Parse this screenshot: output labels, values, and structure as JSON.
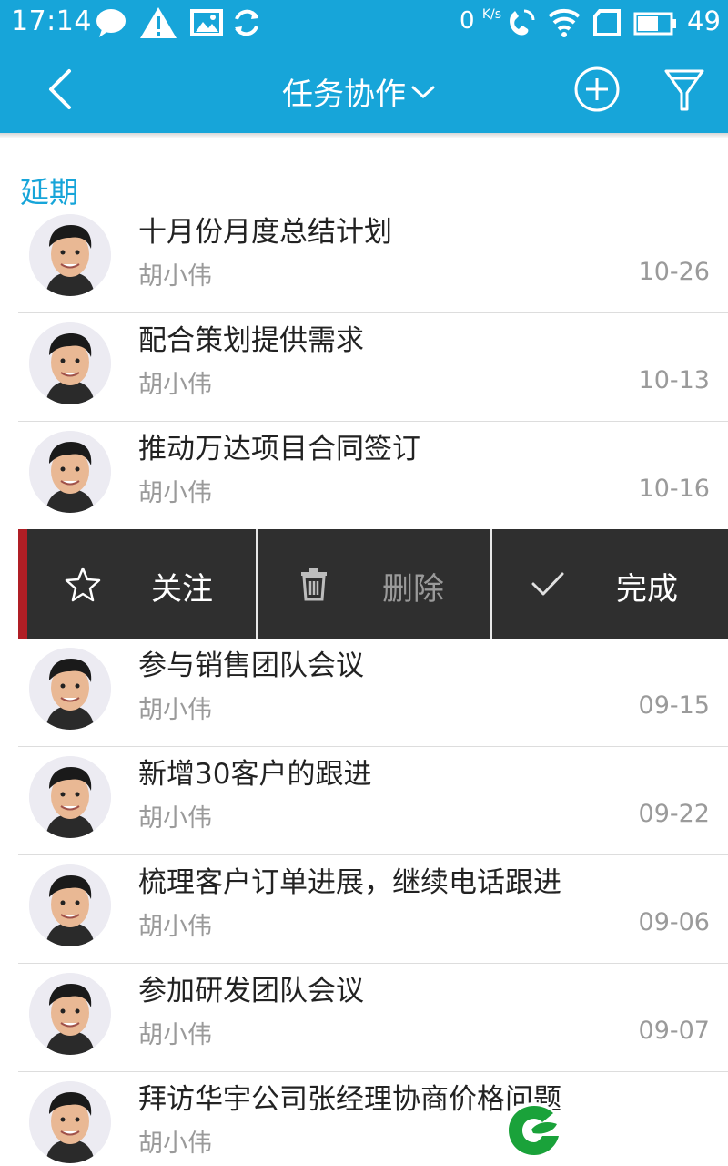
{
  "status_bar": {
    "time": "17:14",
    "net_speed": "0",
    "net_speed_unit": "K/s",
    "battery": "49",
    "icons": [
      "chat-bubble-icon",
      "warning-icon",
      "image-icon",
      "sync-icon",
      "vibrate-icon",
      "wifi-icon",
      "sim-icon",
      "battery-icon"
    ]
  },
  "header": {
    "title": "任务协作",
    "icons": [
      "back-icon",
      "chevron-down-icon",
      "add-circle-icon",
      "filter-icon"
    ]
  },
  "section": {
    "title": "延期"
  },
  "tasks": [
    {
      "title": "十月份月度总结计划",
      "assignee": "胡小伟",
      "date": "10-26"
    },
    {
      "title": "配合策划提供需求",
      "assignee": "胡小伟",
      "date": "10-13"
    },
    {
      "title": "推动万达项目合同签订",
      "assignee": "胡小伟",
      "date": "10-16"
    },
    {
      "title": "参与销售团队会议",
      "assignee": "胡小伟",
      "date": "09-15"
    },
    {
      "title": "新增30客户的跟进",
      "assignee": "胡小伟",
      "date": "09-22"
    },
    {
      "title": "梳理客户订单进展，继续电话跟进",
      "assignee": "胡小伟",
      "date": "09-06"
    },
    {
      "title": "参加研发团队会议",
      "assignee": "胡小伟",
      "date": "09-07"
    },
    {
      "title": "拜访华宇公司张经理协商价格问题",
      "assignee": "胡小伟",
      "date": ""
    }
  ],
  "swipe_actions": {
    "follow": {
      "label": "关注",
      "icon": "star-outline-icon"
    },
    "delete": {
      "label": "删除",
      "icon": "trash-icon"
    },
    "done": {
      "label": "完成",
      "icon": "check-icon"
    }
  },
  "colors": {
    "primary": "#17a5d9",
    "action_bar": "#2f2f2f",
    "action_accent": "#b01e25",
    "logo_green": "#1aa23a",
    "muted_text": "#9a9a9a"
  }
}
